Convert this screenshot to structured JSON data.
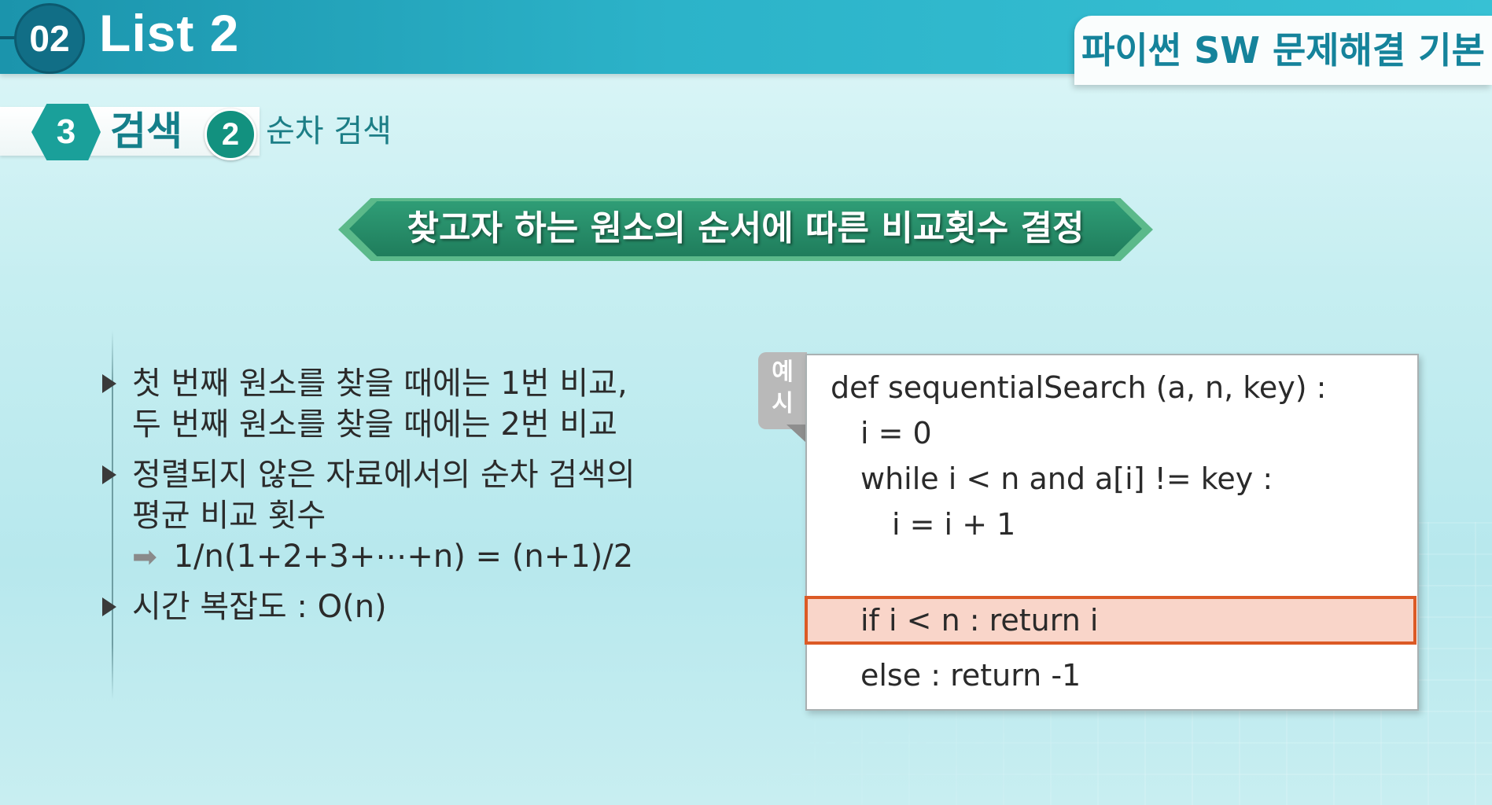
{
  "header": {
    "section_number": "02",
    "title": "List 2",
    "course": "파이썬 SW 문제해결 기본"
  },
  "breadcrumb": {
    "chapter_number": "3",
    "chapter": "검색",
    "sub_number": "2",
    "sub": "순차 검색"
  },
  "banner": {
    "title": "찾고자 하는 원소의 순서에 따른 비교횟수 결정"
  },
  "bullets": [
    {
      "lines": [
        "첫 번째 원소를 찾을 때에는 1번 비교,",
        "두 번째 원소를 찾을 때에는 2번 비교"
      ]
    },
    {
      "lines": [
        "정렬되지 않은 자료에서의 순차 검색의",
        "평균 비교 횟수"
      ],
      "formula_arrow": "➡",
      "formula": "1/n(1+2+3+⋯+n) = (n+1)/2"
    },
    {
      "lines": [
        "시간 복잡도 : O(n)"
      ]
    }
  ],
  "example": {
    "tag_chars": [
      "예",
      "시"
    ],
    "code": [
      "def sequentialSearch (a, n, key) :",
      "i = 0",
      "while i < n and a[i] != key :",
      "i = i + 1",
      "if i < n : return i",
      "else :   return -1"
    ],
    "highlight_color": "#dc5a25"
  },
  "colors": {
    "header": "#2cb3c9",
    "accent_green": "#1f7d5c",
    "text_teal": "#157f8a"
  }
}
